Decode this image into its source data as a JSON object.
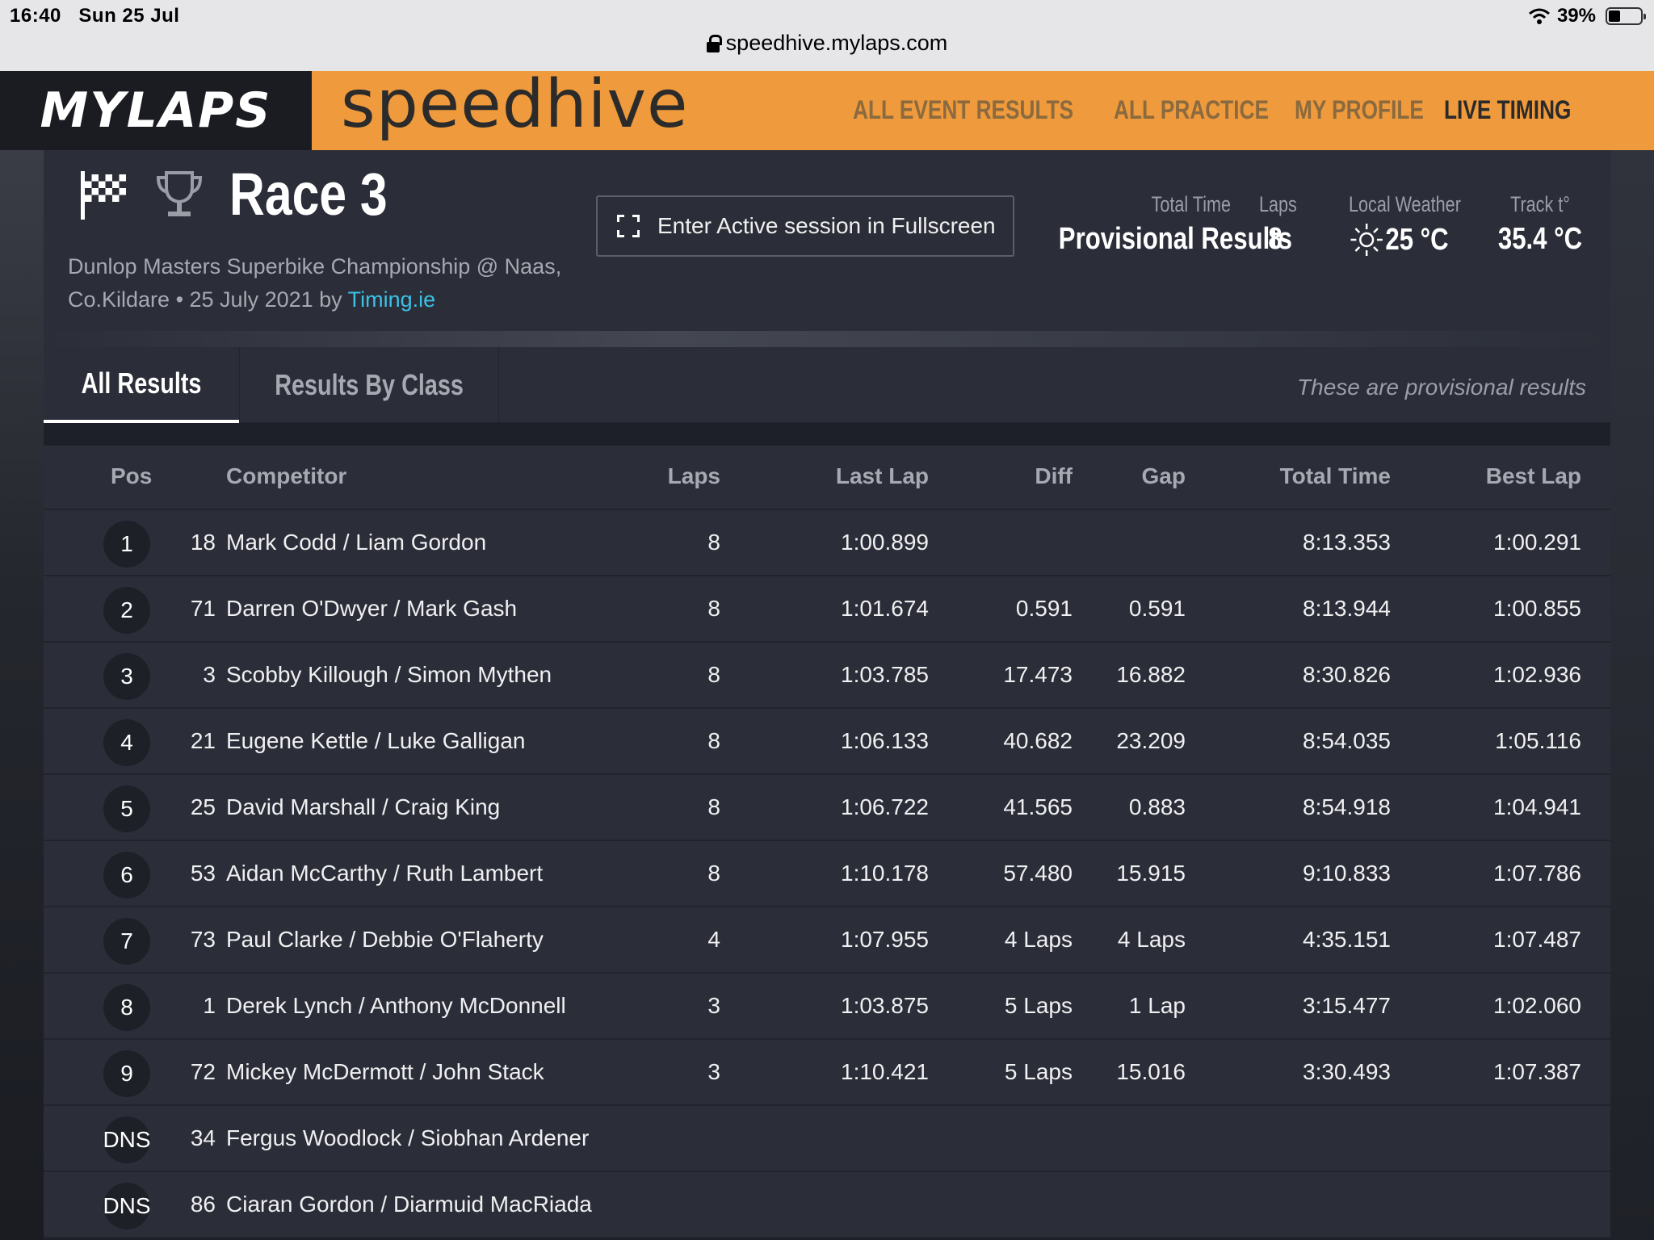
{
  "status_bar": {
    "time": "16:40",
    "date": "Sun 25 Jul",
    "battery": "39%"
  },
  "browser": {
    "url": "speedhive.mylaps.com"
  },
  "nav": {
    "brand": "MYLAPS",
    "product": "speedhive",
    "items": [
      {
        "label": "ALL EVENT RESULTS"
      },
      {
        "label": "ALL PRACTICE"
      },
      {
        "label": "MY PROFILE"
      },
      {
        "label": "LIVE TIMING"
      }
    ],
    "active": "LIVE TIMING"
  },
  "session": {
    "title": "Race 3",
    "event_line1": "Dunlop Masters Superbike Championship @ Naas,",
    "event_line2": "Co.Kildare • 25 July 2021 by",
    "organizer": "Timing.ie",
    "fullscreen_label": "Enter Active session in Fullscreen",
    "stats": {
      "total_time_label": "Total Time",
      "total_time_value": "Provisional Results",
      "laps_label": "Laps",
      "laps_value": "8",
      "weather_label": "Local Weather",
      "weather_value": "25 °C",
      "weather_icon": "sun-icon",
      "track_label": "Track t°",
      "track_value": "35.4 °C"
    }
  },
  "tabs": [
    {
      "label": "All Results"
    },
    {
      "label": "Results By Class"
    }
  ],
  "provisional_note": "These are provisional results",
  "table": {
    "headers": {
      "pos": "Pos",
      "competitor": "Competitor",
      "laps": "Laps",
      "last_lap": "Last Lap",
      "diff": "Diff",
      "gap": "Gap",
      "total_time": "Total Time",
      "best_lap": "Best Lap"
    },
    "rows": [
      {
        "pos": "1",
        "num": "18",
        "name": "Mark Codd / Liam Gordon",
        "laps": "8",
        "last": "1:00.899",
        "diff": "",
        "gap": "",
        "total": "8:13.353",
        "best": "1:00.291"
      },
      {
        "pos": "2",
        "num": "71",
        "name": "Darren O'Dwyer / Mark Gash",
        "laps": "8",
        "last": "1:01.674",
        "diff": "0.591",
        "gap": "0.591",
        "total": "8:13.944",
        "best": "1:00.855"
      },
      {
        "pos": "3",
        "num": "3",
        "name": "Scobby Killough / Simon Mythen",
        "laps": "8",
        "last": "1:03.785",
        "diff": "17.473",
        "gap": "16.882",
        "total": "8:30.826",
        "best": "1:02.936"
      },
      {
        "pos": "4",
        "num": "21",
        "name": "Eugene Kettle / Luke Galligan",
        "laps": "8",
        "last": "1:06.133",
        "diff": "40.682",
        "gap": "23.209",
        "total": "8:54.035",
        "best": "1:05.116"
      },
      {
        "pos": "5",
        "num": "25",
        "name": "David Marshall / Craig King",
        "laps": "8",
        "last": "1:06.722",
        "diff": "41.565",
        "gap": "0.883",
        "total": "8:54.918",
        "best": "1:04.941"
      },
      {
        "pos": "6",
        "num": "53",
        "name": "Aidan McCarthy / Ruth Lambert",
        "laps": "8",
        "last": "1:10.178",
        "diff": "57.480",
        "gap": "15.915",
        "total": "9:10.833",
        "best": "1:07.786"
      },
      {
        "pos": "7",
        "num": "73",
        "name": "Paul Clarke / Debbie O'Flaherty",
        "laps": "4",
        "last": "1:07.955",
        "diff": "4 Laps",
        "gap": "4 Laps",
        "total": "4:35.151",
        "best": "1:07.487"
      },
      {
        "pos": "8",
        "num": "1",
        "name": "Derek Lynch / Anthony McDonnell",
        "laps": "3",
        "last": "1:03.875",
        "diff": "5 Laps",
        "gap": "1 Lap",
        "total": "3:15.477",
        "best": "1:02.060"
      },
      {
        "pos": "9",
        "num": "72",
        "name": "Mickey McDermott / John Stack",
        "laps": "3",
        "last": "1:10.421",
        "diff": "5 Laps",
        "gap": "15.016",
        "total": "3:30.493",
        "best": "1:07.387"
      },
      {
        "pos": "DNS",
        "num": "34",
        "name": "Fergus Woodlock / Siobhan Ardener",
        "laps": "",
        "last": "",
        "diff": "",
        "gap": "",
        "total": "",
        "best": ""
      },
      {
        "pos": "DNS",
        "num": "86",
        "name": "Ciaran Gordon / Diarmuid MacRiada",
        "laps": "",
        "last": "",
        "diff": "",
        "gap": "",
        "total": "",
        "best": ""
      }
    ]
  }
}
